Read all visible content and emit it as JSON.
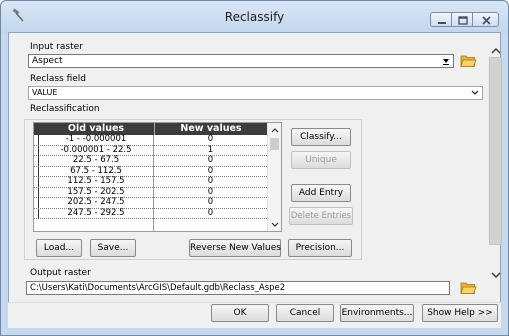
{
  "window": {
    "title": "Reclassify"
  },
  "form": {
    "input_raster_label": "Input raster",
    "input_raster_value": "Aspect",
    "reclass_field_label": "Reclass field",
    "reclass_field_value": "VALUE",
    "reclassification_label": "Reclassification",
    "output_raster_label": "Output raster",
    "output_raster_value": "C:\\Users\\Kati\\Documents\\ArcGIS\\Default.gdb\\Reclass_Aspe2"
  },
  "table": {
    "headers": [
      "Old values",
      "New values"
    ],
    "rows": [
      [
        "-1 - -0.000001",
        "0"
      ],
      [
        "-0.000001 - 22.5",
        "1"
      ],
      [
        "22.5 - 67.5",
        "0"
      ],
      [
        "67.5 - 112.5",
        "0"
      ],
      [
        "112.5 - 157.5",
        "0"
      ],
      [
        "157.5 - 202.5",
        "0"
      ],
      [
        "202.5 - 247.5",
        "0"
      ],
      [
        "247.5 - 292.5",
        "0"
      ]
    ]
  },
  "buttons": {
    "classify": "Classify...",
    "unique": "Unique",
    "add_entry": "Add Entry",
    "delete_entries": "Delete Entries",
    "load": "Load...",
    "save": "Save...",
    "reverse": "Reverse New Values",
    "precision": "Precision...",
    "ok": "OK",
    "cancel": "Cancel",
    "environments": "Environments...",
    "show_help": "Show Help >>"
  }
}
